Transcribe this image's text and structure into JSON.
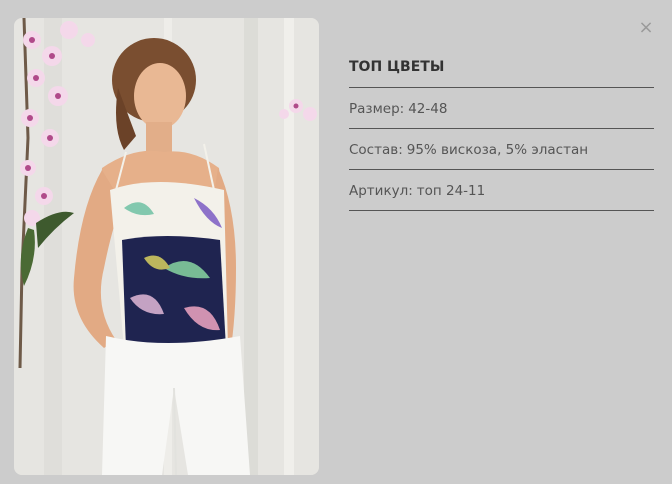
{
  "product": {
    "title": "ТОП ЦВЕТЫ",
    "size_label": "Размер:",
    "size_value": "42-48",
    "composition_label": "Состав:",
    "composition_value": "95% вискоза, 5% эластан",
    "article_label": "Артикул:",
    "article_value": "топ 24-11"
  },
  "controls": {
    "close_glyph": "×"
  },
  "colors": {
    "background": "#cccccc",
    "title": "#333333",
    "text": "#555555",
    "divider": "#555555"
  }
}
